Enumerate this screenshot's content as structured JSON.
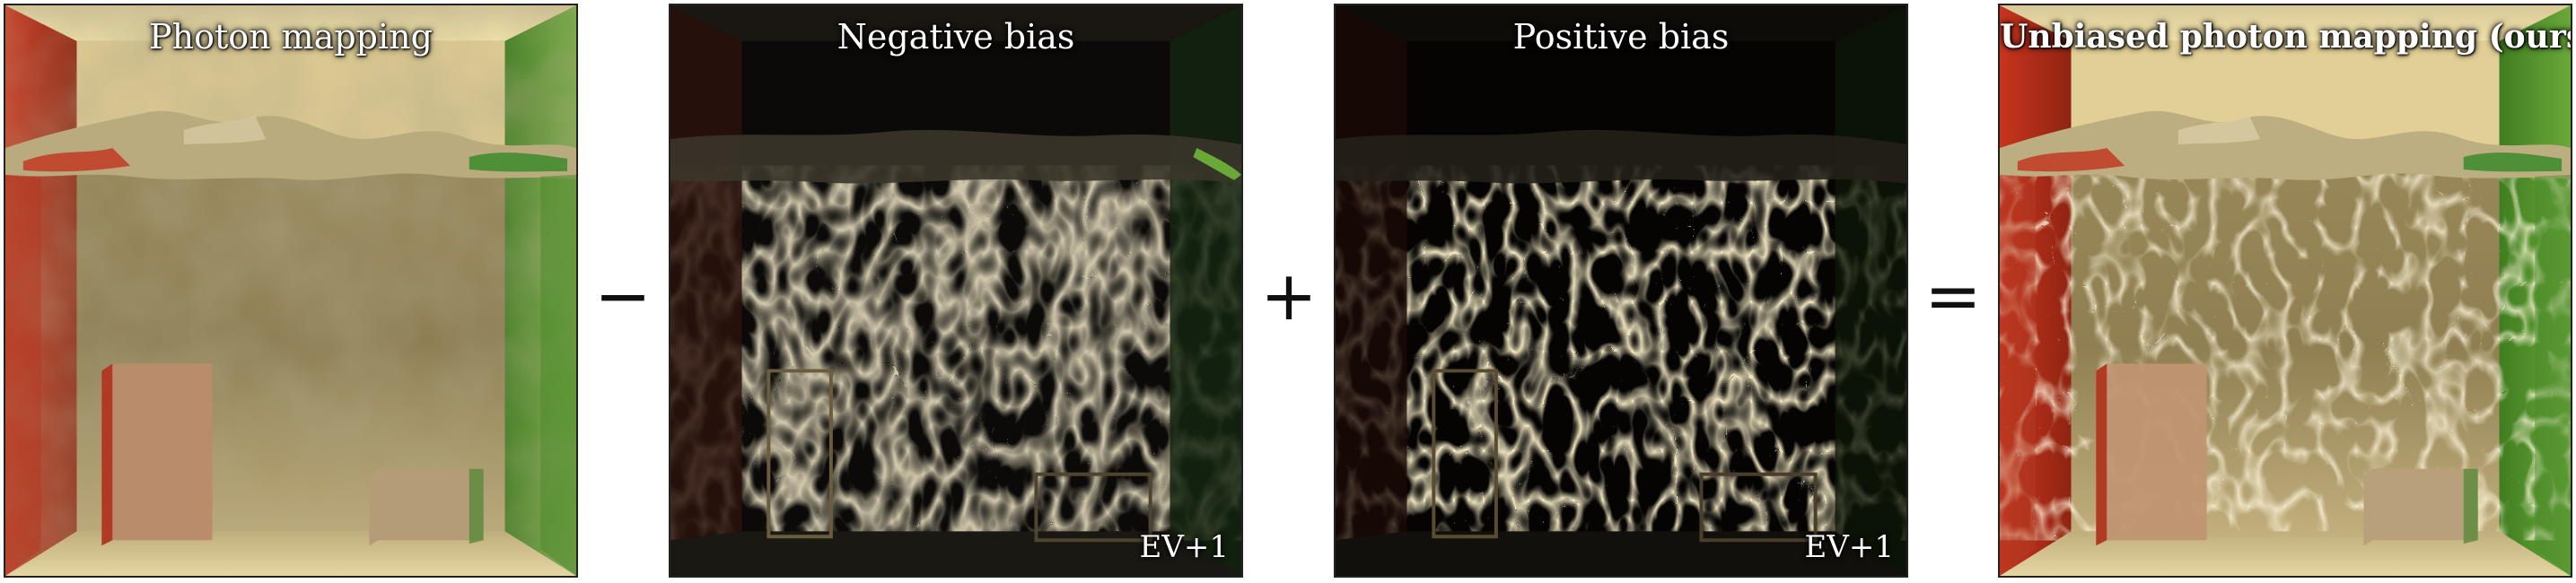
{
  "panels": [
    {
      "title": "Photon mapping"
    },
    {
      "title": "Negative bias",
      "exposure": "EV+1"
    },
    {
      "title": "Positive bias",
      "exposure": "EV+1"
    },
    {
      "title": "Unbiased photon mapping (ours)"
    }
  ],
  "operators": [
    "−",
    "+",
    "="
  ]
}
